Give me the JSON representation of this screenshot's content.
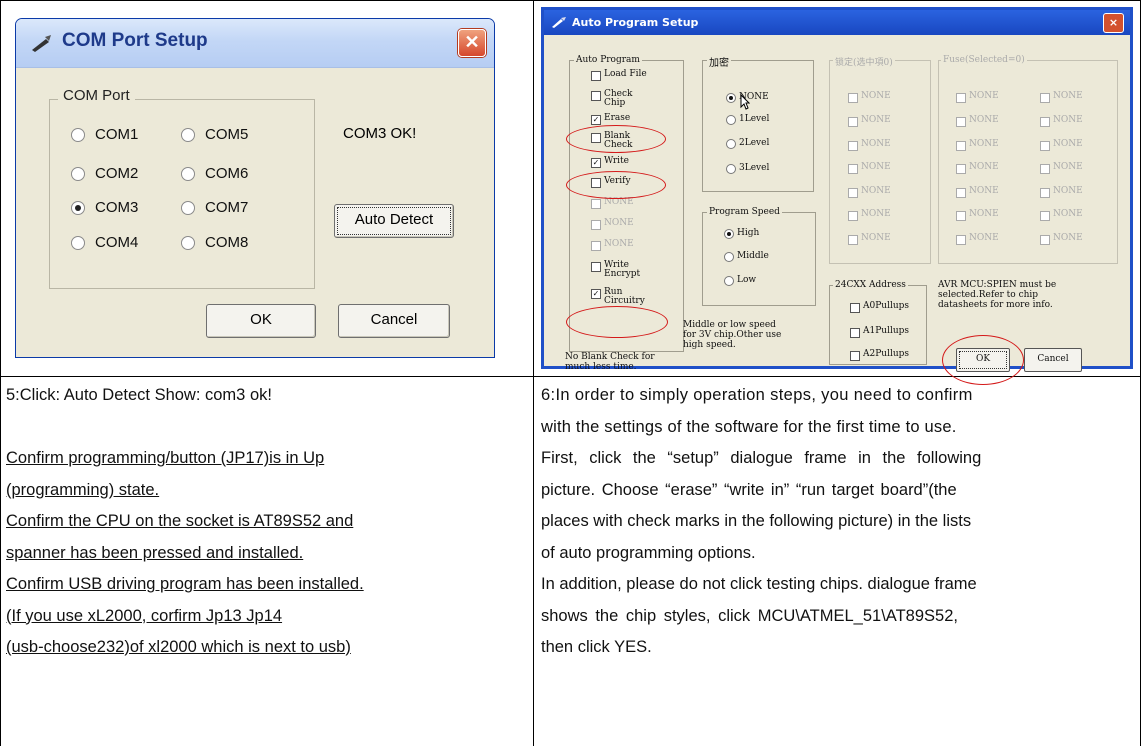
{
  "com_dialog": {
    "title": "COM Port Setup",
    "close_symbol": "✕",
    "group_label": "COM Port",
    "ports": [
      {
        "label": "COM1",
        "selected": false
      },
      {
        "label": "COM2",
        "selected": false
      },
      {
        "label": "COM3",
        "selected": true
      },
      {
        "label": "COM4",
        "selected": false
      },
      {
        "label": "COM5",
        "selected": false
      },
      {
        "label": "COM6",
        "selected": false
      },
      {
        "label": "COM7",
        "selected": false
      },
      {
        "label": "COM8",
        "selected": false
      }
    ],
    "status": "COM3 OK!",
    "auto_detect": "Auto Detect",
    "ok": "OK",
    "cancel": "Cancel"
  },
  "auto_dialog": {
    "title": "Auto Program Setup",
    "close_symbol": "×",
    "auto_program_label": "Auto Program",
    "auto_items": [
      {
        "label": "Load File",
        "checked": false,
        "disabled": false
      },
      {
        "label": "Check\nChip",
        "checked": false,
        "disabled": false
      },
      {
        "label": "Erase",
        "checked": true,
        "disabled": false
      },
      {
        "label": "Blank\nCheck",
        "checked": false,
        "disabled": false
      },
      {
        "label": "Write",
        "checked": true,
        "disabled": false
      },
      {
        "label": "Verify",
        "checked": false,
        "disabled": false
      },
      {
        "label": "NONE",
        "checked": false,
        "disabled": true
      },
      {
        "label": "NONE",
        "checked": false,
        "disabled": true
      },
      {
        "label": "NONE",
        "checked": false,
        "disabled": true
      },
      {
        "label": "Write\nEncrypt",
        "checked": false,
        "disabled": false
      },
      {
        "label": "Run\nCircuitry",
        "checked": true,
        "disabled": false
      }
    ],
    "encrypt_label": "加密",
    "encrypt_options": [
      {
        "label": "NONE",
        "selected": true
      },
      {
        "label": "1Level",
        "selected": false
      },
      {
        "label": "2Level",
        "selected": false
      },
      {
        "label": "3Level",
        "selected": false
      }
    ],
    "speed_label": "Program Speed",
    "speed_options": [
      {
        "label": "High",
        "selected": true
      },
      {
        "label": "Middle",
        "selected": false
      },
      {
        "label": "Low",
        "selected": false
      }
    ],
    "speed_note": "Middle or low speed\nfor 3V chip.Other use\nhigh speed.",
    "blank_note": "No Blank Check for\nmuch less time.",
    "lock_label": "锁定(选中項0)",
    "lock_item": "NONE",
    "fuse_label": "Fuse(Selected=0)",
    "fuse_item": "NONE",
    "addr_label": "24CXX Address",
    "addr_items": [
      "A0Pullups",
      "A1Pullups",
      "A2Pullups"
    ],
    "avr_note": "AVR MCU:SPIEN must be\nselected.Refer to chip\ndatasheets for more info.",
    "ok": "OK",
    "cancel": "Cancel",
    "highlight_color": "#d41a1a"
  },
  "left_text": {
    "step": "5:Click: Auto Detect    Show: com3 ok!",
    "lines": [
      "Confirm programming/button (JP17)is in Up ",
      "(programming) state.",
      "Confirm the CPU on the    socket is AT89S52 and",
      "spanner has been pressed and installed.",
      "Confirm USB driving program has been installed.",
      "(If you use xL2000, corfirm Jp13 Jp14 ",
      "(usb-choose232)of xl2000 which is next to usb)"
    ]
  },
  "right_text": {
    "lines": [
      "6:In order to simply operation steps, you need to confirm",
      "with the settings of the software for the first time to use.",
      "First, click the “setup” dialogue frame in the following",
      "picture. Choose “erase” “write in” “run target board”(the",
      "places with check marks in the following picture) in the lists",
      "of auto programming options.",
      "In addition, please do not click testing chips. dialogue frame",
      "shows the chip styles, click MCU\\ATMEL_51\\AT89S52,",
      "then click YES."
    ]
  }
}
